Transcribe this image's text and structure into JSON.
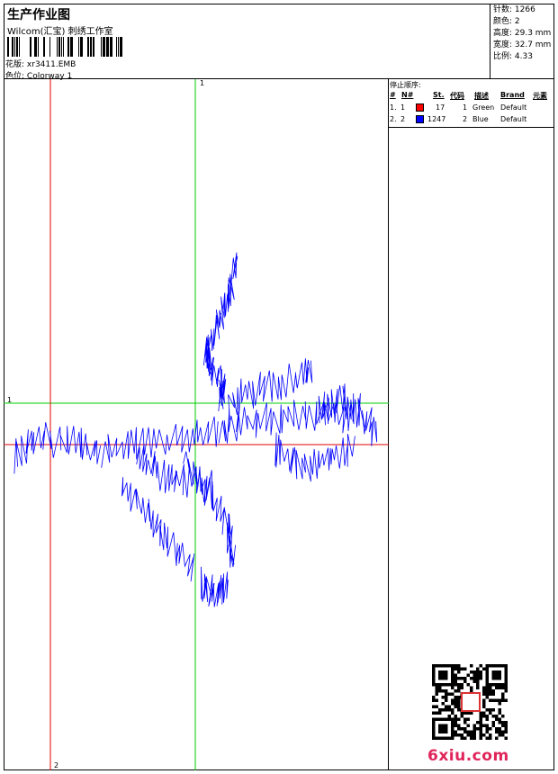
{
  "header": {
    "title": "生产作业图",
    "company": "Wilcom(汇宝) 刺绣工作室",
    "pattern_label": "花版:",
    "pattern_value": "xr3411.EMB",
    "colorway_label": "色位:",
    "colorway_value": "Colorway 1"
  },
  "stats": {
    "stitches": "针数: 1266",
    "colors": "颜色: 2",
    "height": "高度: 29.3 mm",
    "width": "宽度: 32.7 mm",
    "scale": "比例: 4.33"
  },
  "canvas": {
    "label_top": "1",
    "label_left": "1",
    "label_bottom": "2",
    "line_colors": {
      "guide_green": "#00cc00",
      "guide_red": "#e00000",
      "stitch": "#0000ff"
    }
  },
  "stop_sequence": {
    "title": "停止顺序:",
    "columns": [
      "#",
      "N#",
      "St.",
      "代码",
      "描述",
      "Brand",
      "元素"
    ],
    "rows": [
      {
        "index": "1.",
        "n": "1",
        "color": "#ff0000",
        "stitches": "17",
        "code": "1",
        "desc": "Green",
        "brand": "Default"
      },
      {
        "index": "2.",
        "n": "2",
        "color": "#0000ff",
        "stitches": "1247",
        "code": "2",
        "desc": "Blue",
        "brand": "Default"
      }
    ]
  },
  "watermark": {
    "site": "6xiu.com"
  }
}
